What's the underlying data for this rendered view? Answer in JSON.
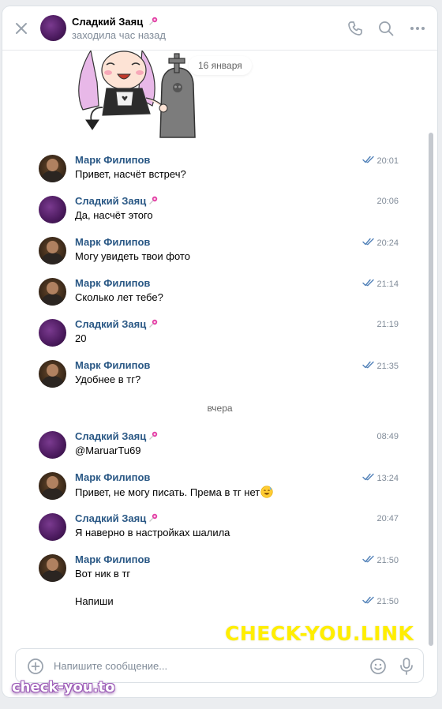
{
  "header": {
    "name": "Сладкий Заяц",
    "status": "заходила час назад"
  },
  "sticker": {
    "date_pill": "16 января",
    "icon": "anime-girl-tombstone-sticker"
  },
  "messages": [
    {
      "author": "Марк Филипов",
      "text": "Привет, насчёт встреч?",
      "time": "20:01",
      "from": "mark",
      "read": true
    },
    {
      "author": "Сладкий Заяц",
      "text": "Да, насчёт этого",
      "time": "20:06",
      "from": "zayats",
      "read": false
    },
    {
      "author": "Марк Филипов",
      "text": "Могу увидеть твои фото",
      "time": "20:24",
      "from": "mark",
      "read": true
    },
    {
      "author": "Марк Филипов",
      "text": "Сколько лет тебе?",
      "time": "21:14",
      "from": "mark",
      "read": true
    },
    {
      "author": "Сладкий Заяц",
      "text": "20",
      "time": "21:19",
      "from": "zayats",
      "read": false
    },
    {
      "author": "Марк Филипов",
      "text": "Удобнее в тг?",
      "time": "21:35",
      "from": "mark",
      "read": true
    },
    {
      "author": "Сладкий Заяц",
      "text": "@MaruarTu69",
      "time": "08:49",
      "from": "zayats",
      "read": false
    },
    {
      "author": "Марк Филипов",
      "text": "Привет, не могу писать. Према в тг нет",
      "time": "13:24",
      "from": "mark",
      "read": true,
      "emoji": "sweat-smile-emoji"
    },
    {
      "author": "Сладкий Заяц",
      "text": "Я наверно в настройках шалила",
      "time": "20:47",
      "from": "zayats",
      "read": false
    },
    {
      "author": "Марк Филипов",
      "text": "Вот ник в тг",
      "time": "21:50",
      "from": "mark",
      "read": true
    },
    {
      "author": "",
      "text": "Напиши",
      "time": "21:50",
      "from": "mark",
      "read": true
    }
  ],
  "day_separator": "вчера",
  "composer": {
    "placeholder": "Напишите сообщение..."
  },
  "watermarks": {
    "primary": "CHECK-YOU.LINK",
    "secondary": "check-you.to"
  },
  "colors": {
    "author_link": "#2a5885",
    "check_blue": "#5181b8",
    "watermark_yellow": "#ffee00"
  }
}
